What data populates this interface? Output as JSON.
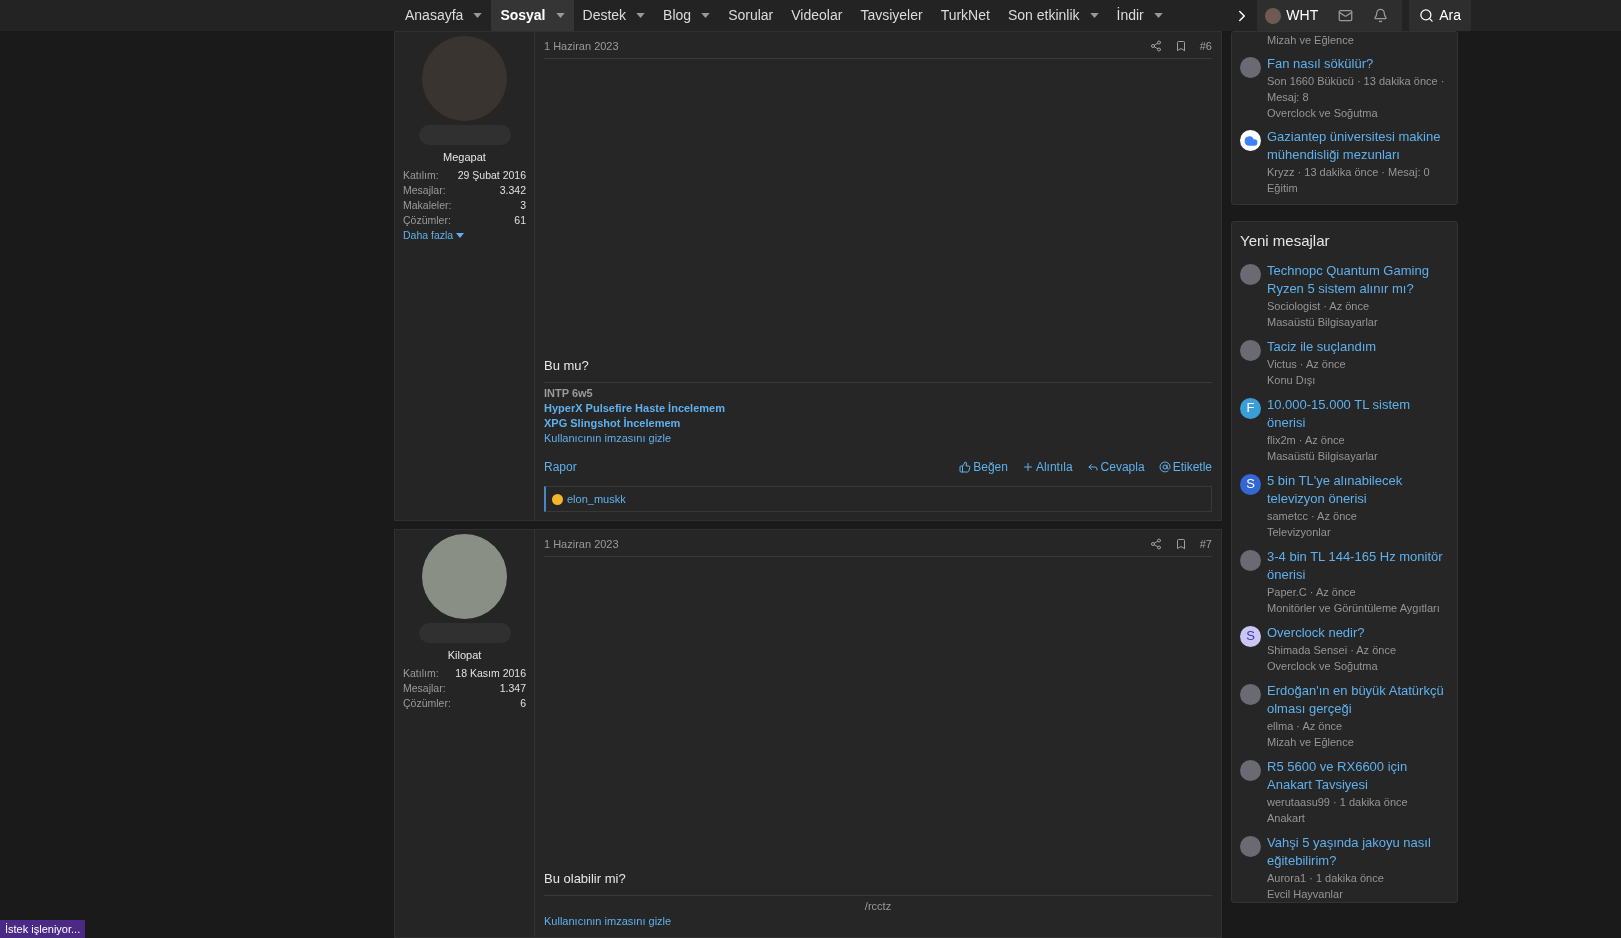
{
  "nav": {
    "items": [
      {
        "label": "Anasayfa",
        "selected": false,
        "dropdown": true
      },
      {
        "label": "Sosyal",
        "selected": true,
        "dropdown": true
      },
      {
        "label": "Destek",
        "selected": false,
        "dropdown": true
      },
      {
        "label": "Blog",
        "selected": false,
        "dropdown": true
      },
      {
        "label": "Sorular",
        "selected": false,
        "dropdown": false
      },
      {
        "label": "Videolar",
        "selected": false,
        "dropdown": false
      },
      {
        "label": "Tavsiyeler",
        "selected": false,
        "dropdown": false
      },
      {
        "label": "TurkNet",
        "selected": false,
        "dropdown": false
      },
      {
        "label": "Son etkinlik",
        "selected": false,
        "dropdown": true
      },
      {
        "label": "İndir",
        "selected": false,
        "dropdown": true
      }
    ],
    "user": {
      "name": "WHT"
    },
    "search": {
      "label": "Ara"
    }
  },
  "posts": [
    {
      "date": "1 Haziran 2023",
      "number": "#6",
      "user": {
        "name": "Megapat",
        "stats": [
          {
            "label": "Katılım:",
            "value": "29 Şubat 2016"
          },
          {
            "label": "Mesajlar:",
            "value": "3.342"
          },
          {
            "label": "Makaleler:",
            "value": "3"
          },
          {
            "label": "Çözümler:",
            "value": "61"
          }
        ],
        "more": "Daha fazla"
      },
      "body": "Bu mu?",
      "signature": [
        {
          "kind": "bold",
          "text": "INTP 6w5"
        },
        {
          "kind": "link",
          "text": "HyperX Pulsefire Haste İncelemem"
        },
        {
          "kind": "link",
          "text": "XPG Slingshot İncelemem"
        }
      ],
      "hide_signature": "Kullanıcının imzasını gizle",
      "report": "Rapor",
      "actions": [
        {
          "kind": "like",
          "label": "Beğen"
        },
        {
          "kind": "quote",
          "label": "Alıntıla"
        },
        {
          "kind": "reply",
          "label": "Cevapla"
        },
        {
          "kind": "mention",
          "label": "Etiketle"
        }
      ],
      "reactions": "elon_muskk"
    },
    {
      "date": "1 Haziran 2023",
      "number": "#7",
      "user": {
        "name": "Kilopat",
        "stats": [
          {
            "label": "Katılım:",
            "value": "18 Kasım 2016"
          },
          {
            "label": "Mesajlar:",
            "value": "1.347"
          },
          {
            "label": "Çözümler:",
            "value": "6"
          }
        ]
      },
      "body": "Bu olabilir mi?",
      "signature": [
        {
          "kind": "center",
          "text": "/rcctz"
        }
      ],
      "hide_signature": "Kullanıcının imzasını gizle"
    }
  ],
  "sidebar": {
    "top_card": {
      "items": [
        {
          "forum": "Mizah ve Eğlence"
        },
        {
          "avatar": {
            "kind": "photo"
          },
          "title": "Fan nasıl sökülür?",
          "meta": "Son 1660 Bükücü · 13 dakika önce · Mesaj: 8",
          "forum": "Overclock ve Soğutma"
        },
        {
          "avatar": {
            "kind": "cloud"
          },
          "title": "Gaziantep üniversitesi makine mühendisliği mezunları",
          "meta": "Kryzz · 13 dakika önce · Mesaj: 0",
          "forum": "Eğitim"
        }
      ]
    },
    "new_messages": {
      "title": "Yeni mesajlar",
      "items": [
        {
          "avatar": {
            "kind": "photo"
          },
          "title": "Technopc Quantum Gaming Ryzen 5 sistem alınır mı?",
          "meta": "Sociologist · Az önce",
          "forum": "Masaüstü Bilgisayarlar"
        },
        {
          "avatar": {
            "kind": "photo"
          },
          "title": "Taciz ile suçlandım",
          "meta": "Victus · Az önce",
          "forum": "Konu Dışı"
        },
        {
          "avatar": {
            "kind": "letter",
            "letter": "F",
            "color": "#3a9fd6"
          },
          "title": "10.000-15.000 TL sistem önerisi",
          "meta": "flix2m · Az önce",
          "forum": "Masaüstü Bilgisayarlar"
        },
        {
          "avatar": {
            "kind": "letter",
            "letter": "S",
            "color": "#3566d6"
          },
          "title": "5 bin TL'ye alınabilecek televizyon önerisi",
          "meta": "sametcc · Az önce",
          "forum": "Televizyonlar"
        },
        {
          "avatar": {
            "kind": "photo"
          },
          "title": "3-4 bin TL 144-165 Hz monitör önerisi",
          "meta": "Paper.C · Az önce",
          "forum": "Monitörler ve Görüntüleme Aygıtları"
        },
        {
          "avatar": {
            "kind": "letter",
            "letter": "S",
            "color": "#cbc6f4"
          },
          "title": "Overclock nedir?",
          "meta": "Shimada Sensei · Az önce",
          "forum": "Overclock ve Soğutma"
        },
        {
          "avatar": {
            "kind": "photo"
          },
          "title": "Erdoğan'ın en büyük Atatürkçü olması gerçeği",
          "meta": "ellma · Az önce",
          "forum": "Mizah ve Eğlence"
        },
        {
          "avatar": {
            "kind": "photo"
          },
          "title": "R5 5600 ve RX6600 için Anakart Tavsiyesi",
          "meta": "werutaasu99 · 1 dakika önce",
          "forum": "Anakart"
        },
        {
          "avatar": {
            "kind": "photo"
          },
          "title": "Vahşi 5 yaşında jakoyu nasıl eğitebilirim?",
          "meta": "Aurora1 · 1 dakika önce",
          "forum": "Evcil Hayvanlar"
        }
      ]
    }
  },
  "status_bar": "İstek işleniyor..."
}
